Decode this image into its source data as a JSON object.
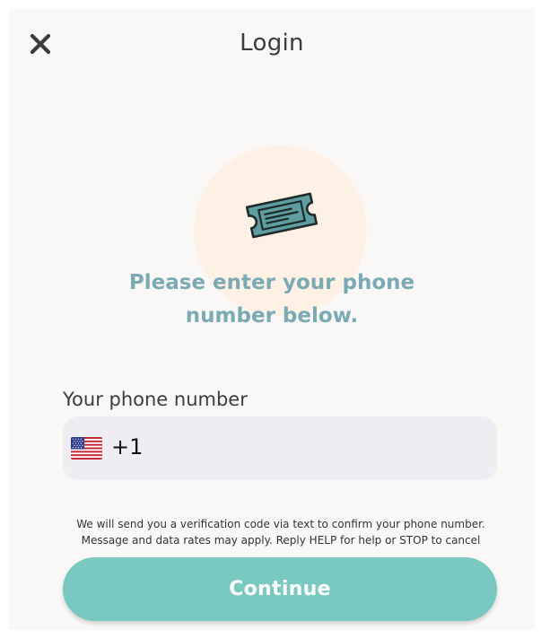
{
  "header": {
    "title": "Login",
    "close_icon": "close-icon"
  },
  "hero": {
    "icon": "ticket-icon",
    "prompt_line1": "Please enter your phone",
    "prompt_line2": "number below."
  },
  "phone": {
    "label": "Your phone number",
    "country_flag_icon": "us-flag-icon",
    "dial_code": "+1",
    "value": ""
  },
  "disclaimer": {
    "line1": "We will send you a verification code via text to confirm your phone number.",
    "line2": "Message and data rates may apply.  Reply HELP for help or STOP to cancel"
  },
  "actions": {
    "continue_label": "Continue"
  },
  "colors": {
    "background": "#faf8f6",
    "accent": "#79c9c1",
    "prompt_text": "#7aaab3",
    "hero_circle": "#fdf1e5",
    "input_background": "#efedf2",
    "ticket_fill": "#5f9ea0"
  }
}
